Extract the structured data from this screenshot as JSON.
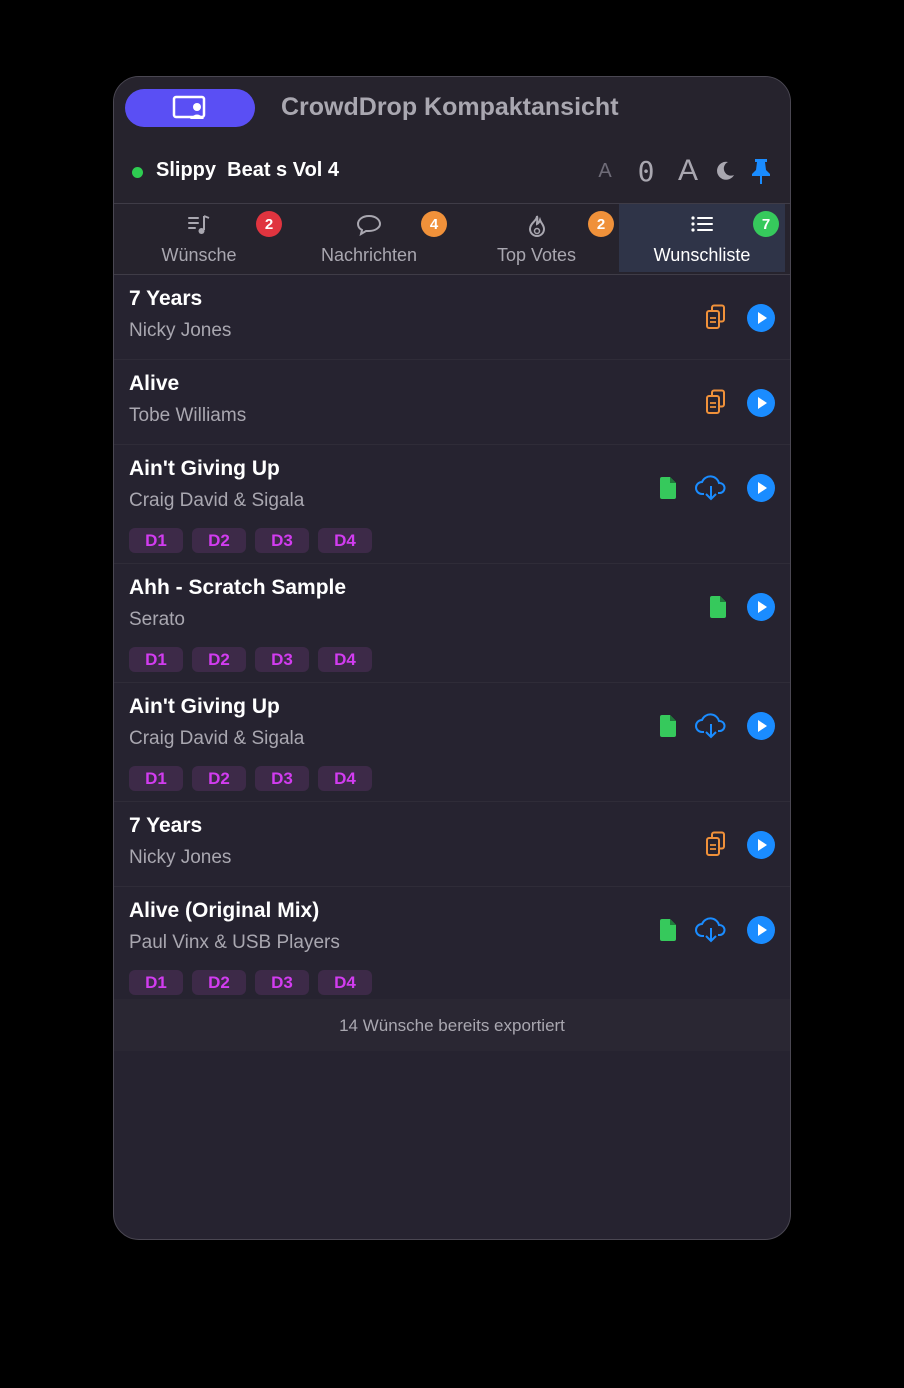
{
  "app": {
    "title": "CrowdDrop Kompaktansicht"
  },
  "event": {
    "name": "Slippy  Beat s Vol 4",
    "status": "live",
    "zoom_value": "0",
    "font_small_label": "A",
    "font_large_label": "A"
  },
  "colors": {
    "accent": "#5a4ff4",
    "play": "#1a8cff",
    "orange": "#f0913a",
    "green": "#36c95c",
    "chip_text": "#d23cf0",
    "chip_bg": "#3d2a48"
  },
  "tabs": [
    {
      "label": "Wünsche",
      "badge": "2",
      "badge_color": "#e0343f",
      "icon": "music-list-icon"
    },
    {
      "label": "Nachrichten",
      "badge": "4",
      "badge_color": "#f0913a",
      "icon": "speech-bubble-icon"
    },
    {
      "label": "Top Votes",
      "badge": "2",
      "badge_color": "#f0913a",
      "icon": "flame-icon"
    },
    {
      "label": "Wunschliste",
      "badge": "7",
      "badge_color": "#36c95c",
      "icon": "list-icon",
      "active": true
    }
  ],
  "items": [
    {
      "title": "7 Years",
      "artist": "Nicky Jones",
      "source": "copy",
      "decks": []
    },
    {
      "title": "Alive",
      "artist": "Tobe Williams",
      "source": "copy",
      "decks": []
    },
    {
      "title": "Ain't Giving Up",
      "artist": "Craig David & Sigala",
      "source": "file-cloud",
      "decks": [
        "D1",
        "D2",
        "D3",
        "D4"
      ]
    },
    {
      "title": "Ahh - Scratch Sample",
      "artist": "Serato",
      "source": "file",
      "decks": [
        "D1",
        "D2",
        "D3",
        "D4"
      ]
    },
    {
      "title": "Ain't Giving Up",
      "artist": "Craig David & Sigala",
      "source": "file-cloud",
      "decks": [
        "D1",
        "D2",
        "D3",
        "D4"
      ]
    },
    {
      "title": "7 Years",
      "artist": "Nicky Jones",
      "source": "copy",
      "decks": []
    },
    {
      "title": "Alive (Original Mix)",
      "artist": "Paul Vinx & USB Players",
      "source": "file-cloud",
      "decks": [
        "D1",
        "D2",
        "D3",
        "D4"
      ]
    }
  ],
  "footer": {
    "text": "14 Wünsche bereits exportiert"
  }
}
